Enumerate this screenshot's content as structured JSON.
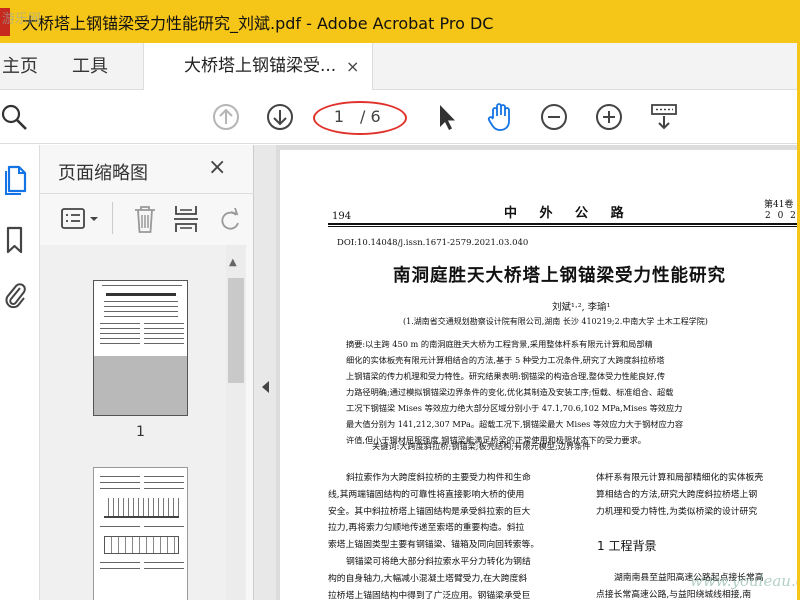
{
  "window": {
    "title": "大桥塔上钢锚梁受力性能研究_刘斌.pdf - Adobe Acrobat Pro DC"
  },
  "tabs": {
    "home": "主页",
    "tools": "工具",
    "document": "大桥塔上钢锚梁受...",
    "close": "×"
  },
  "toolbar": {
    "current_page": "1",
    "total_pages": "/ 6",
    "icons": [
      "search-icon",
      "page-up-icon",
      "page-down-icon",
      "select-arrow-icon",
      "hand-icon",
      "zoom-out-icon",
      "zoom-in-icon",
      "keyboard-scroll-icon"
    ],
    "annotation_color": "#e0332b"
  },
  "side_panel": {
    "title": "页面缩略图",
    "close": "×",
    "thumbnail_label": "1"
  },
  "document": {
    "page_number": "194",
    "journal": "中 外 公 路",
    "volume": "第41卷",
    "date": "2 0 2 1",
    "doi": "DOI:10.14048/j.issn.1671-2579.2021.03.040",
    "title": "南洞庭胜天大桥塔上钢锚梁受力性能研究",
    "authors": "刘斌¹·², 李瑜¹",
    "affiliation": "(1.湖南省交通规划勘察设计院有限公司,湖南 长沙 410219;2.中南大学 土木工程学院)",
    "abstract_lines": [
      "摘要:以主跨 450 m 的南洞庭胜天大桥为工程背景,采用整体杆系有限元计算和局部精",
      "细化的实体板壳有限元计算相结合的方法,基于 5 种受力工况条件,研究了大跨度斜拉桥塔",
      "上钢锚梁的传力机理和受力特性。研究结果表明:钢锚梁的构造合理,整体受力性能良好,传",
      "力路径明确;通过模拟钢锚梁边界条件的变化,优化其制造及安装工序;恒载、标准组合、超载",
      "工况下钢锚梁 Mises 等效应力绝大部分区域分别小于 47.1,70.6,102 MPa,Mises 等效应力",
      "最大值分别为 141,212,307 MPa。超载工况下,钢锚梁最大 Mises 等效应力大于钢材应力容",
      "许值,但小于钢材屈服强度,钢锚梁能满足桥梁的正常使用和极限状态下的受力要求。"
    ],
    "keywords": "关键词:大跨度斜拉桥;钢锚梁;板壳结构;有限元模型;边界条件",
    "left_column": [
      "斜拉索作为大跨度斜拉桥的主要受力构件和生命",
      "线,其两端锚固结构的可靠性将直接影响大桥的使用",
      "安全。其中斜拉桥塔上锚固结构是承受斜拉索的巨大",
      "拉力,再将索力匀顺地传递至索塔的重要构造。斜拉",
      "索塔上锚固类型主要有钢锚梁、锚箱及同向回转索等。",
      "钢锚梁可将绝大部分斜拉索水平分力转化为钢结",
      "构的自身轴力,大幅减小混凝土塔臂受力,在大跨度斜",
      "拉桥塔上锚固结构中得到了广泛应用。钢锚梁承受巨"
    ],
    "right_column_top": [
      "体杆系有限元计算和局部精细化的实体板壳",
      "算相结合的方法,研究大跨度斜拉桥塔上钢",
      "力机理和受力特性,为类似桥梁的设计研究"
    ],
    "section_heading": "1  工程背景",
    "right_column_bottom": [
      "湖南南县至益阳高速公路起点接长常高",
      "点接长常高速公路,与益阳绕城线相接,南"
    ]
  },
  "watermarks": {
    "top_left": "游乐网",
    "bottom_right": "www.youleau.com"
  }
}
